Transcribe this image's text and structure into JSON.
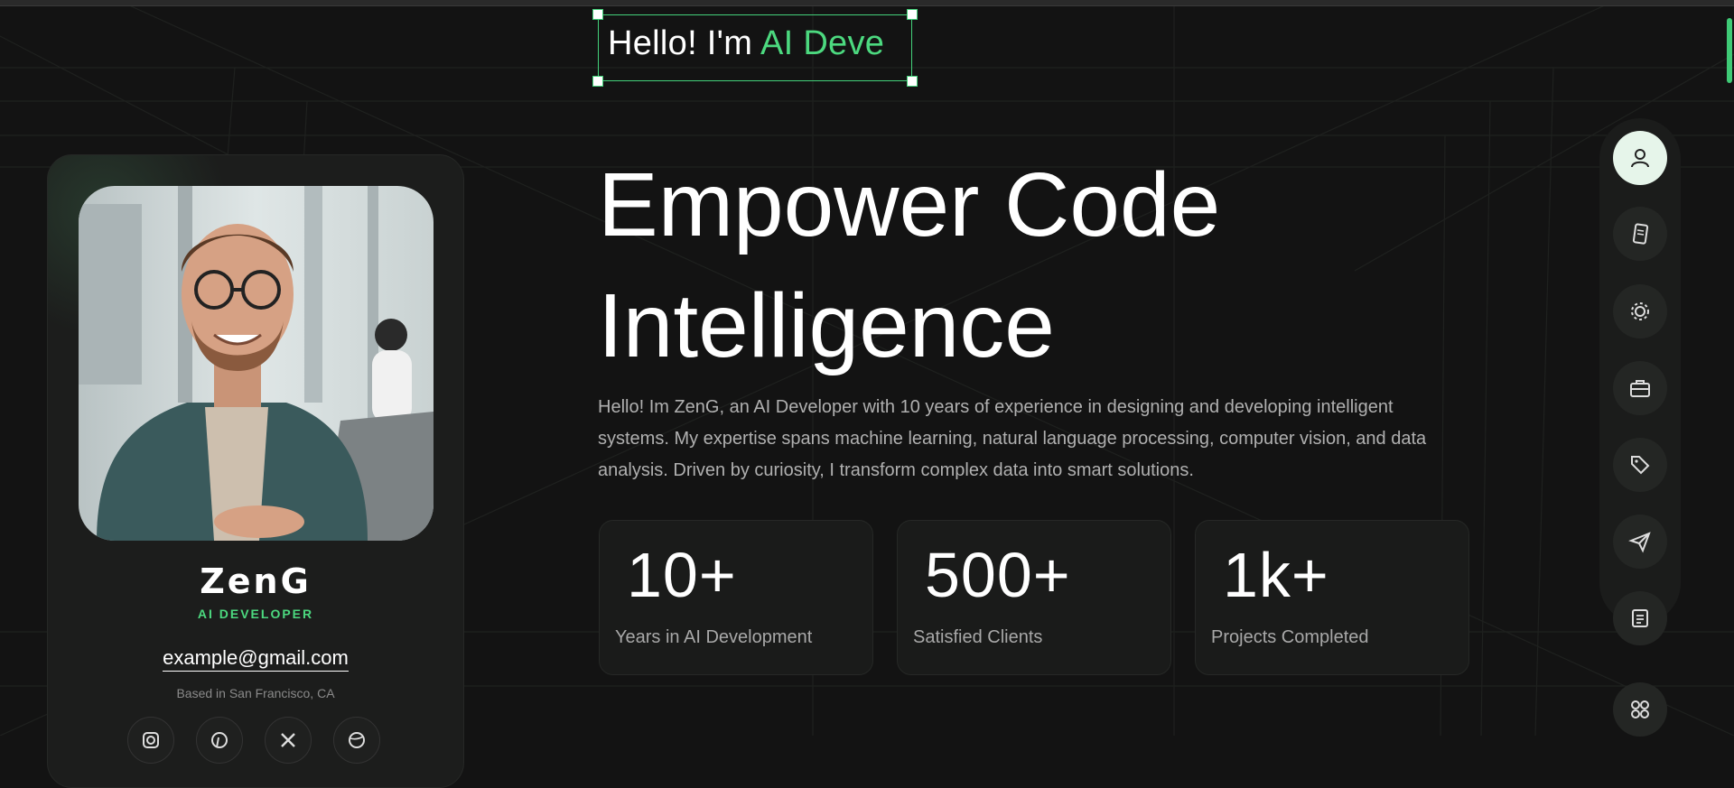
{
  "hero": {
    "greeting_prefix": "Hello! I'm ",
    "greeting_accent": "AI Deve",
    "headline_line1": "Empower Code",
    "headline_line2": "Intelligence",
    "intro": "Hello! Im ZenG, an AI Developer with 10 years of experience in designing and developing intelligent systems. My expertise spans machine learning, natural language processing, computer vision, and data analysis. Driven by curiosity, I transform complex data into smart solutions."
  },
  "profile": {
    "name": "ZenG",
    "role": "AI DEVELOPER",
    "email": "example@gmail.com",
    "location": "Based in San Francisco, CA",
    "socials": [
      "instagram-icon",
      "pinterest-icon",
      "x-icon",
      "dribbble-icon"
    ]
  },
  "stats": [
    {
      "value": "10+",
      "label": "Years in AI Development"
    },
    {
      "value": "500+",
      "label": "Satisfied Clients"
    },
    {
      "value": "1k+",
      "label": "Projects Completed"
    }
  ],
  "nav": [
    "user-icon",
    "resume-icon",
    "gear-icon",
    "briefcase-icon",
    "tag-icon",
    "send-icon",
    "document-icon",
    "apps-icon"
  ],
  "colors": {
    "accent": "#4cd97f",
    "background": "#131313",
    "card": "#1c1d1c"
  }
}
